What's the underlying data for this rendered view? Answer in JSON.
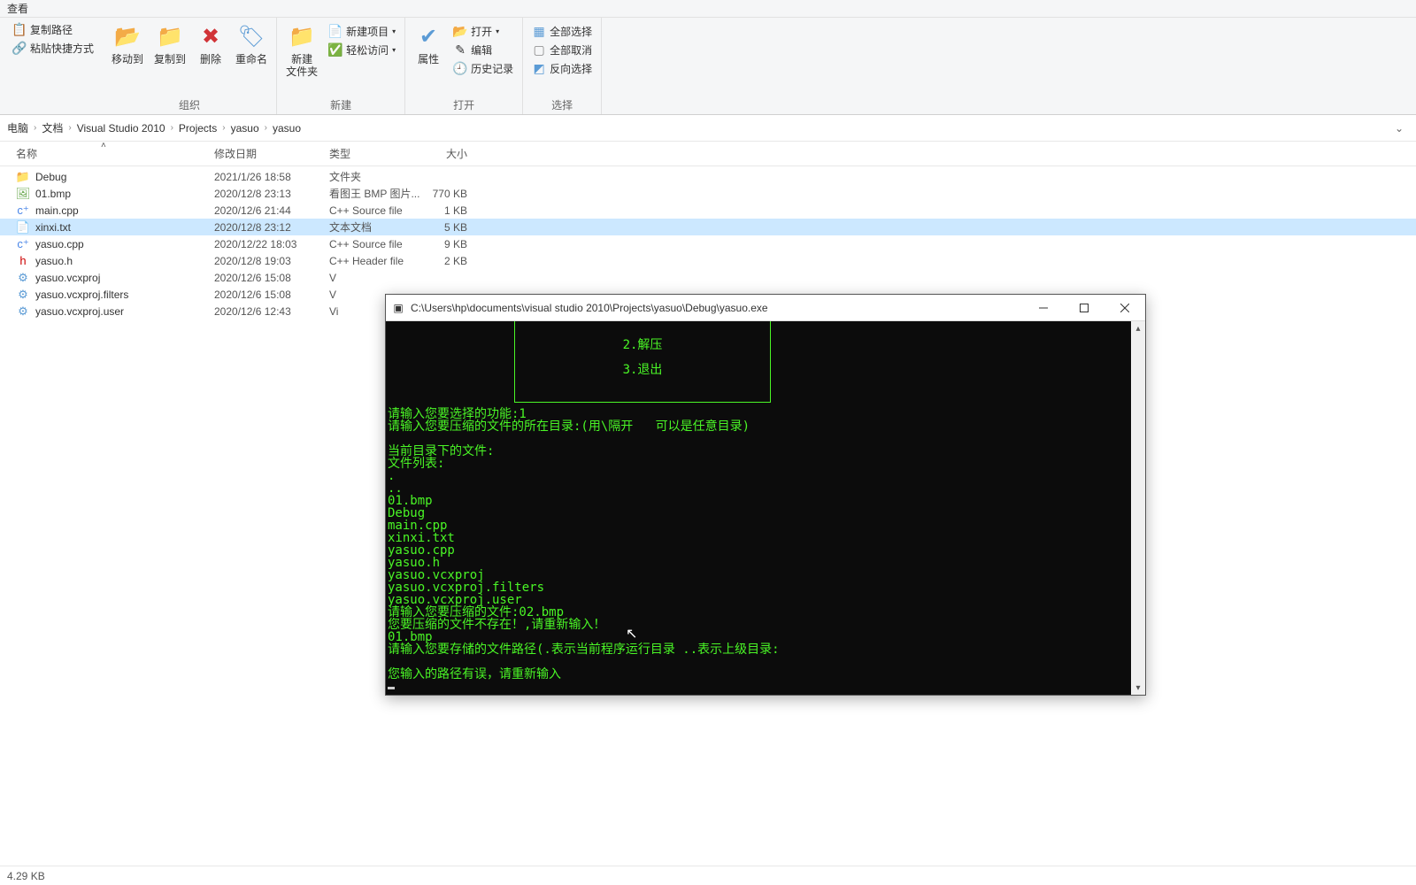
{
  "tabTitle": "查看",
  "ribbon": {
    "clipboard": {
      "copyPath": "复制路径",
      "pasteShortcut": "粘贴快捷方式"
    },
    "organize": {
      "label": "组织",
      "moveTo": "移动到",
      "copyTo": "复制到",
      "delete": "删除",
      "rename": "重命名"
    },
    "new": {
      "label": "新建",
      "newFolder": "新建\n文件夹",
      "newItem": "新建项目",
      "easyAccess": "轻松访问"
    },
    "open": {
      "label": "打开",
      "properties": "属性",
      "open": "打开",
      "edit": "编辑",
      "history": "历史记录"
    },
    "select": {
      "label": "选择",
      "selectAll": "全部选择",
      "selectNone": "全部取消",
      "invert": "反向选择"
    }
  },
  "breadcrumb": [
    "电脑",
    "文档",
    "Visual Studio 2010",
    "Projects",
    "yasuo",
    "yasuo"
  ],
  "columns": {
    "name": "名称",
    "date": "修改日期",
    "type": "类型",
    "size": "大小"
  },
  "files": [
    {
      "icon": "folder",
      "name": "Debug",
      "date": "2021/1/26 18:58",
      "type": "文件夹",
      "size": ""
    },
    {
      "icon": "bmp",
      "name": "01.bmp",
      "date": "2020/12/8 23:13",
      "type": "看图王 BMP 图片...",
      "size": "770 KB"
    },
    {
      "icon": "cpp",
      "name": "main.cpp",
      "date": "2020/12/6 21:44",
      "type": "C++ Source file",
      "size": "1 KB"
    },
    {
      "icon": "txt",
      "name": "xinxi.txt",
      "date": "2020/12/8 23:12",
      "type": "文本文档",
      "size": "5 KB",
      "selected": true
    },
    {
      "icon": "cpp",
      "name": "yasuo.cpp",
      "date": "2020/12/22 18:03",
      "type": "C++ Source file",
      "size": "9 KB"
    },
    {
      "icon": "h",
      "name": "yasuo.h",
      "date": "2020/12/8 19:03",
      "type": "C++ Header file",
      "size": "2 KB"
    },
    {
      "icon": "proj",
      "name": "yasuo.vcxproj",
      "date": "2020/12/6 15:08",
      "type": "V",
      "size": ""
    },
    {
      "icon": "proj",
      "name": "yasuo.vcxproj.filters",
      "date": "2020/12/6 15:08",
      "type": "V",
      "size": ""
    },
    {
      "icon": "proj",
      "name": "yasuo.vcxproj.user",
      "date": "2020/12/6 12:43",
      "type": "Vi",
      "size": ""
    }
  ],
  "status": "4.29 KB",
  "console": {
    "title": "C:\\Users\\hp\\documents\\visual studio 2010\\Projects\\yasuo\\Debug\\yasuo.exe",
    "menu2": "2.解压",
    "menu3": "3.退出",
    "lines": [
      "请输入您要选择的功能:1",
      "请输入您要压缩的文件的所在目录:(用\\隔开   可以是任意目录)",
      "",
      "当前目录下的文件:",
      "文件列表:",
      ".",
      "..",
      "01.bmp",
      "Debug",
      "main.cpp",
      "xinxi.txt",
      "yasuo.cpp",
      "yasuo.h",
      "yasuo.vcxproj",
      "yasuo.vcxproj.filters",
      "yasuo.vcxproj.user",
      "请输入您要压缩的文件:02.bmp",
      "您要压缩的文件不存在！,请重新输入！",
      "01.bmp",
      "请输入您要存储的文件路径(.表示当前程序运行目录 ..表示上级目录:",
      "",
      "您输入的路径有误，请重新输入"
    ]
  }
}
